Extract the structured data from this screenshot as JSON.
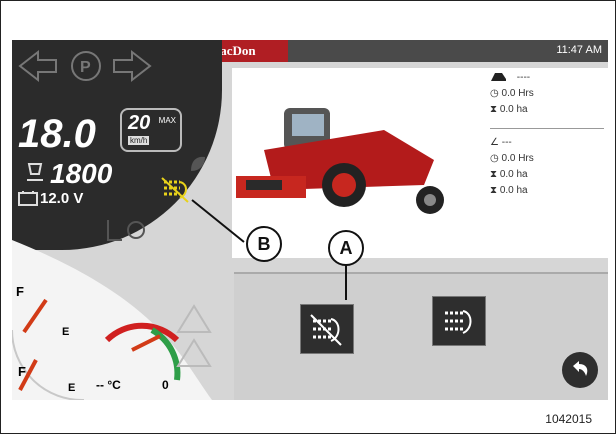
{
  "header": {
    "brand": "MacDon",
    "time": "11:47 AM"
  },
  "dash": {
    "speed": "18.0",
    "max_speed": "20",
    "max_label": "MAX",
    "speed_unit": "km/h",
    "rpm": "1800",
    "voltage": "12.0 V"
  },
  "stats": {
    "group1": {
      "label": "----",
      "hours": "0.0 Hrs",
      "area": "0.0 ha"
    },
    "group2": {
      "label": "---",
      "hours": "0.0 Hrs",
      "area": "0.0 ha",
      "area2": "0.0 ha"
    }
  },
  "gauges": {
    "fuel_f": "F",
    "fuel_e": "E",
    "def_f": "F",
    "def_e": "E",
    "temp": "-- °C",
    "gear": "0"
  },
  "callouts": {
    "a": "A",
    "b": "B"
  },
  "figure_number": "1042015",
  "colors": {
    "brand_red": "#b01e23",
    "panel_dark": "#2b2b2b",
    "warning_yellow": "#e8d21a"
  }
}
